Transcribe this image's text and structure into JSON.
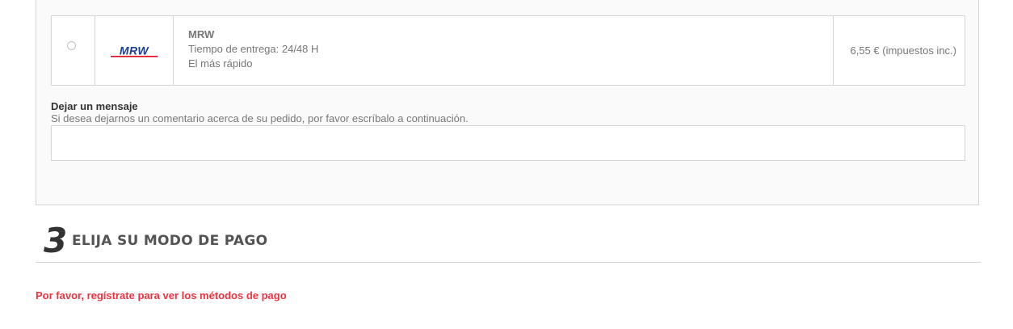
{
  "carrier_option": {
    "logo_text": "MRW",
    "name": "MRW",
    "delivery_time": "Tiempo de entrega: 24/48 H",
    "tagline": "El más rápido",
    "price": "6,55 € (impuestos inc.)",
    "selected": false
  },
  "message": {
    "label": "Dejar un mensaje",
    "help": "Si desea dejarnos un comentario acerca de su pedido, por favor escríbalo a continuación.",
    "value": ""
  },
  "payment_step": {
    "number": "3",
    "title": "ELIJA SU MODO DE PAGO",
    "warning": "Por favor, regístrate para ver los métodos de pago"
  },
  "colors": {
    "logo_blue": "#1c3f94",
    "logo_red": "#e2001a",
    "warning_red": "#f13340"
  }
}
